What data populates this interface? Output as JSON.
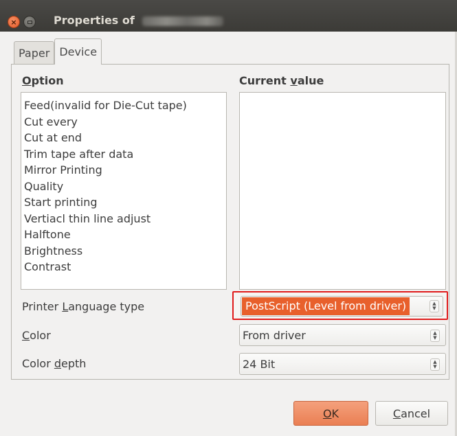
{
  "window": {
    "title": "Properties of"
  },
  "tabs": [
    {
      "label": "Paper",
      "active": false
    },
    {
      "label": "Device",
      "active": true
    }
  ],
  "columns": {
    "option_header_first": "O",
    "option_header_rest": "ption",
    "value_header_pre": "Current ",
    "value_header_ul": "v",
    "value_header_post": "alue"
  },
  "options": [
    "Feed(invalid for Die-Cut tape)",
    "Cut every",
    "Cut at end",
    "Trim tape after data",
    "Mirror Printing",
    "Quality",
    "Start printing",
    "Vertiacl thin line adjust",
    "Halftone",
    "Brightness",
    "Contrast"
  ],
  "settings": {
    "language_label_pre": "Printer ",
    "language_label_ul": "L",
    "language_label_post": "anguage type",
    "language_value": "PostScript (Level from driver)",
    "color_label_ul": "C",
    "color_label_post": "olor",
    "color_value": "From driver",
    "depth_label_pre": "Color ",
    "depth_label_ul": "d",
    "depth_label_post": "epth",
    "depth_value": "24 Bit"
  },
  "buttons": {
    "ok_ul": "O",
    "ok_post": "K",
    "cancel_ul": "C",
    "cancel_post": "ancel"
  },
  "colors": {
    "highlight": "#e8602c",
    "callout_border": "#e01b1b",
    "ok_button": "#ea7f53"
  }
}
